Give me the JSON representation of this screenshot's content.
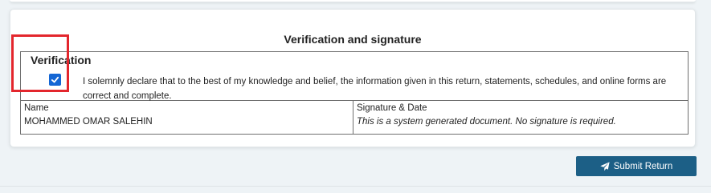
{
  "section": {
    "title": "Verification and signature"
  },
  "verification": {
    "heading": "Verification",
    "checked": true,
    "declaration": "I solemnly declare that to the best of my knowledge and belief, the information given in this return, statements, schedules, and online forms are correct and complete."
  },
  "signatory": {
    "name_label": "Name",
    "name_value": "MOHAMMED OMAR SALEHIN",
    "signature_label": "Signature & Date",
    "signature_value": "This is a system generated document. No signature is required."
  },
  "actions": {
    "submit_label": "Submit Return",
    "submit_icon": "paper-plane-icon"
  },
  "colors": {
    "accent": "#1466d4",
    "button": "#1c5f86",
    "highlight": "#e3262d",
    "background": "#eef3f6"
  }
}
